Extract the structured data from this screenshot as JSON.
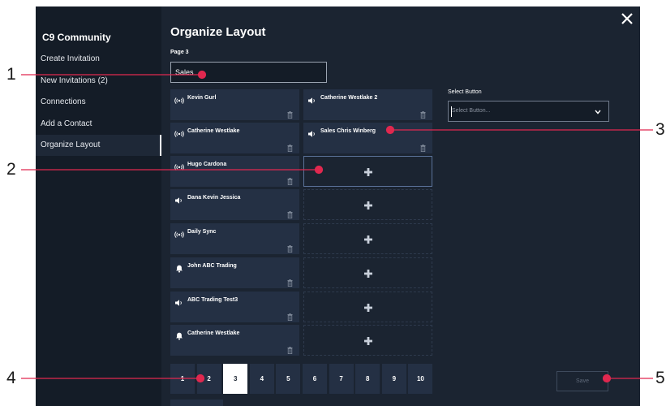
{
  "sidebar": {
    "title": "C9 Community",
    "items": [
      {
        "label": "Create Invitation",
        "active": false
      },
      {
        "label": "New Invitations (2)",
        "active": false
      },
      {
        "label": "Connections",
        "active": false
      },
      {
        "label": "Add a Contact",
        "active": false
      },
      {
        "label": "Organize Layout",
        "active": true
      }
    ]
  },
  "main": {
    "title": "Organize Layout",
    "page_label": "Page 3",
    "page_name_value": "Sales",
    "left_column": [
      {
        "label": "Kevin Gurl",
        "icon": "broadcast-icon"
      },
      {
        "label": "Catherine Westlake",
        "icon": "broadcast-icon"
      },
      {
        "label": "Hugo Cardona",
        "icon": "broadcast-icon"
      },
      {
        "label": "Dana Kevin Jessica",
        "icon": "speaker-icon"
      },
      {
        "label": "Daily Sync",
        "icon": "broadcast-icon"
      },
      {
        "label": "John ABC Trading",
        "icon": "bell-icon"
      },
      {
        "label": "ABC Trading Test3",
        "icon": "speaker-icon"
      },
      {
        "label": "Catherine Westlake",
        "icon": "bell-icon"
      }
    ],
    "right_column": [
      {
        "label": "Catherine Westlake 2",
        "icon": "speaker-icon"
      },
      {
        "label": "Sales Chris Winberg",
        "icon": "speaker-icon"
      }
    ],
    "empty_slots": 6,
    "select_button": {
      "label": "Select Button",
      "placeholder": "Select Button..."
    },
    "pagination": {
      "pages": [
        "1",
        "2",
        "3",
        "4",
        "5",
        "6",
        "7",
        "8",
        "9",
        "10"
      ],
      "active": "3"
    },
    "save_label": "Save"
  },
  "callouts": [
    "1",
    "2",
    "3",
    "4",
    "5"
  ],
  "colors": {
    "panel": "#1b2431",
    "sidebar": "#141c27",
    "card": "#243044",
    "callout_line": "#e0284f"
  }
}
